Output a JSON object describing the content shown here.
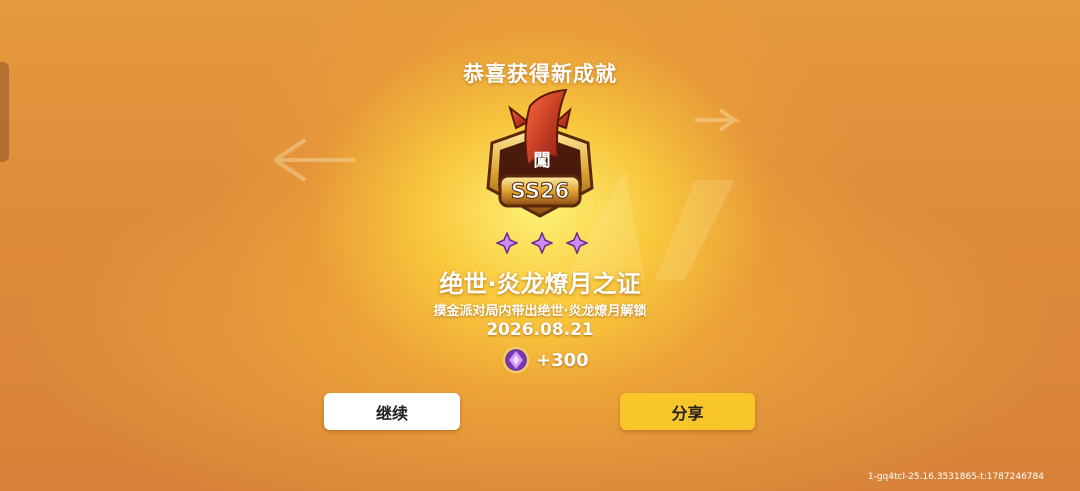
{
  "header": {
    "title": "恭喜获得新成就"
  },
  "badge": {
    "season_label": "SS26",
    "glyph": "闖"
  },
  "achievement": {
    "stars": 3,
    "name": "绝世·炎龙燎月之证",
    "description": "摸金派对局内带出绝世·炎龙燎月解锁",
    "date": "2026.08.21"
  },
  "reward": {
    "icon": "purple-gem-icon",
    "amount": "+300"
  },
  "buttons": {
    "continue_label": "继续",
    "share_label": "分享"
  },
  "footer": {
    "build_id": "1-gq4tcl-25.16.3531865-t:1787246784"
  },
  "colors": {
    "share_button": "#f8c62b",
    "continue_button": "#ffffff",
    "background": "#d9843a"
  }
}
